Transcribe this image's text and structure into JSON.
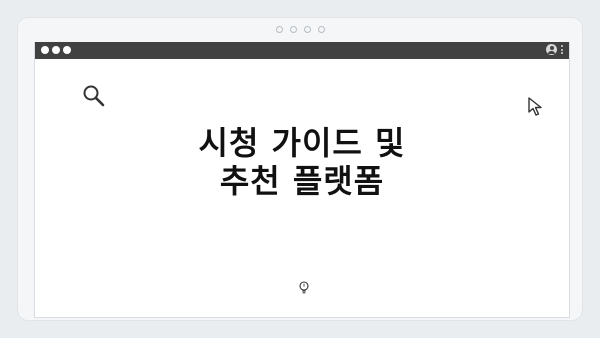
{
  "window": {
    "titlebar_lights": [
      "close",
      "minimize",
      "maximize"
    ],
    "titlebar_right_icons": [
      "user-icon",
      "kebab-menu-icon"
    ]
  },
  "slide": {
    "title_line1": "시청 가이드 및",
    "title_line2": "추천 플랫폼"
  },
  "icons": {
    "search": "search-icon",
    "cursor": "cursor-icon",
    "bulb": "lightbulb-icon"
  },
  "colors": {
    "titlebar": "#414141",
    "background": "#e9edf0",
    "text": "#111111"
  }
}
